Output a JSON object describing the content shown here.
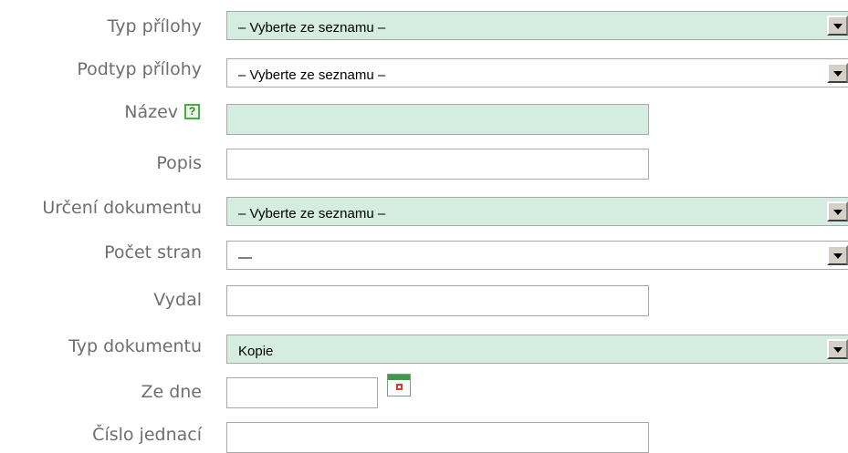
{
  "fields": {
    "typ_prilohy": {
      "label": "Typ přílohy",
      "value": "– Vyberte ze seznamu –"
    },
    "podtyp_prilohy": {
      "label": "Podtyp přílohy",
      "value": "– Vyberte ze seznamu –"
    },
    "nazev": {
      "label": "Název",
      "value": "",
      "help_icon": "?"
    },
    "popis": {
      "label": "Popis",
      "value": ""
    },
    "urceni_dokumentu": {
      "label": "Určení dokumentu",
      "value": "– Vyberte ze seznamu –"
    },
    "pocet_stran": {
      "label": "Počet stran",
      "value": "—"
    },
    "vydal": {
      "label": "Vydal",
      "value": ""
    },
    "typ_dokumentu": {
      "label": "Typ dokumentu",
      "value": "Kopie"
    },
    "ze_dne": {
      "label": "Ze dne",
      "value": ""
    },
    "cislo_jednaci": {
      "label": "Číslo jednací",
      "value": ""
    }
  },
  "colors": {
    "required_field_bg": "#d4ede0",
    "label_text": "#6e6e6e",
    "field_border": "#a8a8a8"
  },
  "icons": {
    "help": "help-icon",
    "calendar": "calendar-icon"
  }
}
